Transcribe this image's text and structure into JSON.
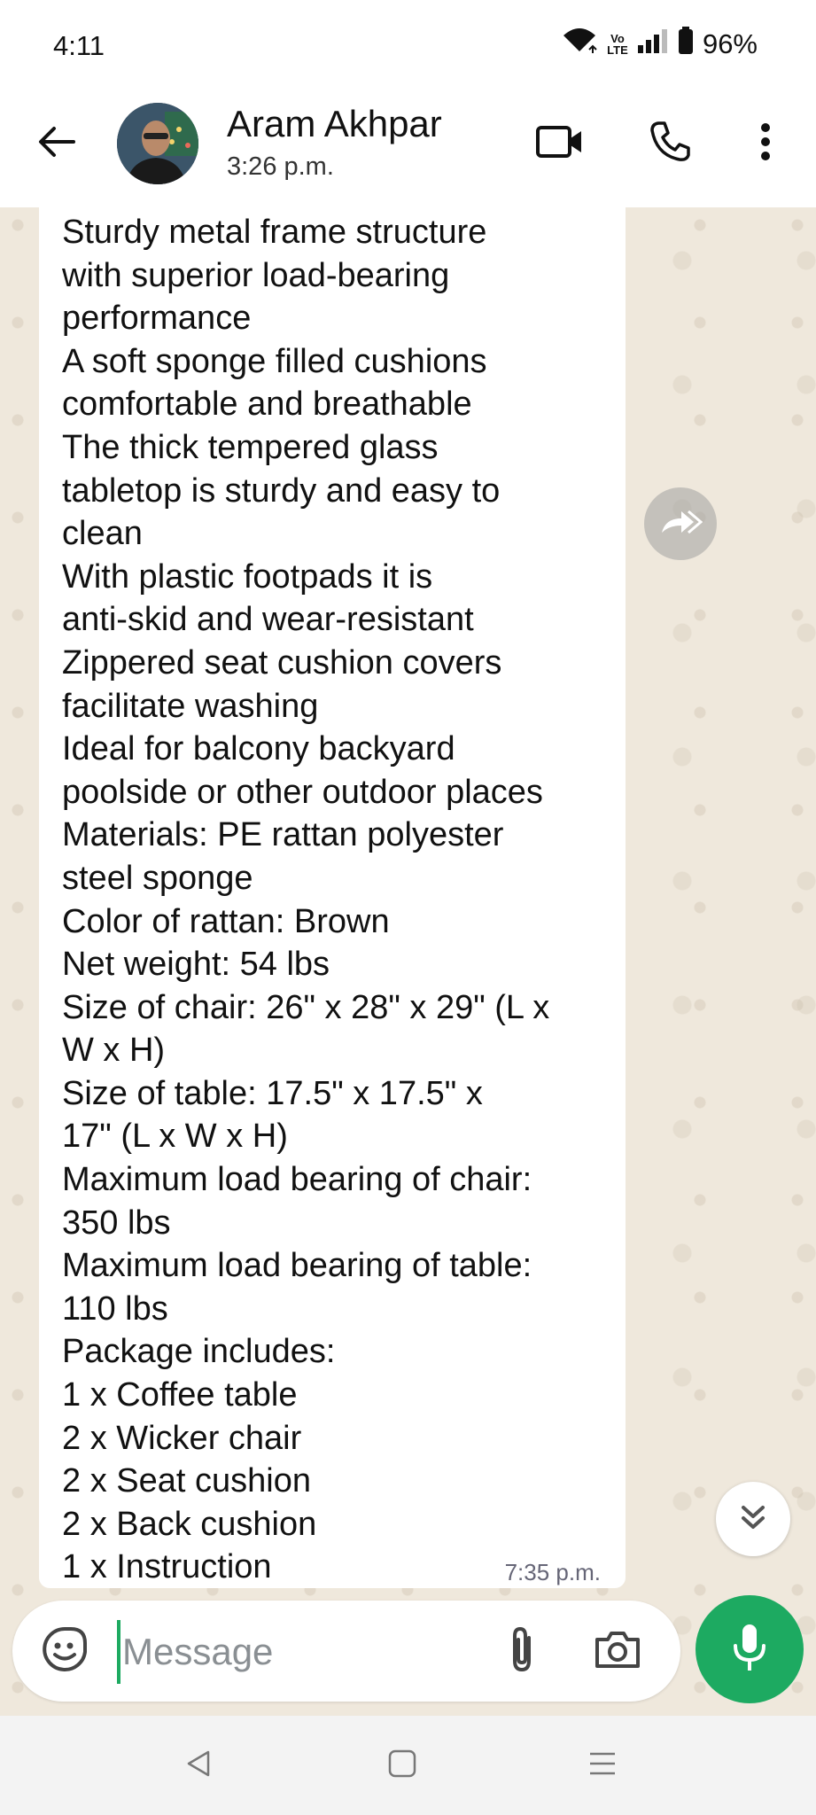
{
  "status_bar": {
    "time": "4:11",
    "battery": "96%",
    "network_label_top": "Vo",
    "network_label_bottom": "LTE",
    "icons": [
      "wifi-icon",
      "volte-icon",
      "signal-icon",
      "battery-icon"
    ]
  },
  "header": {
    "contact_name": "Aram Akhpar",
    "contact_status": "3:26 p.m.",
    "icons": [
      "back-arrow-icon",
      "video-call-icon",
      "phone-icon",
      "more-vertical-icon"
    ]
  },
  "message": {
    "lines": [
      "Sturdy metal frame structure",
      "with superior load-bearing",
      "performance",
      "A soft sponge filled cushions",
      "comfortable and breathable",
      "The thick tempered glass",
      "tabletop is sturdy and easy to",
      "clean",
      "With plastic footpads it is",
      "anti-skid and wear-resistant",
      "Zippered seat cushion covers",
      "facilitate washing",
      "Ideal for balcony backyard",
      "poolside or other outdoor places",
      "Materials: PE rattan polyester",
      "steel sponge",
      "Color of rattan: Brown",
      "Net weight: 54 lbs",
      "Size of chair: 26\" x 28\" x 29\" (L x",
      "W x H)",
      "Size of table: 17.5\" x 17.5\" x",
      "17\" (L x W x H)",
      "Maximum load bearing of chair:",
      "350 lbs",
      "Maximum load bearing of table:",
      "110 lbs",
      "Package includes:",
      "1 x Coffee table",
      "2 x Wicker chair",
      "2 x Seat cushion",
      "2 x Back cushion",
      "1 x Instruction"
    ],
    "time": "7:35 p.m."
  },
  "composer": {
    "placeholder": "Message",
    "icons": [
      "sticker-icon",
      "attach-icon",
      "camera-icon",
      "mic-icon"
    ]
  },
  "colors": {
    "accent": "#1daa61",
    "chat_background": "#efe8dc",
    "bubble": "#ffffff"
  },
  "nav": {
    "icons": [
      "nav-back-icon",
      "nav-home-icon",
      "nav-recents-icon"
    ]
  }
}
